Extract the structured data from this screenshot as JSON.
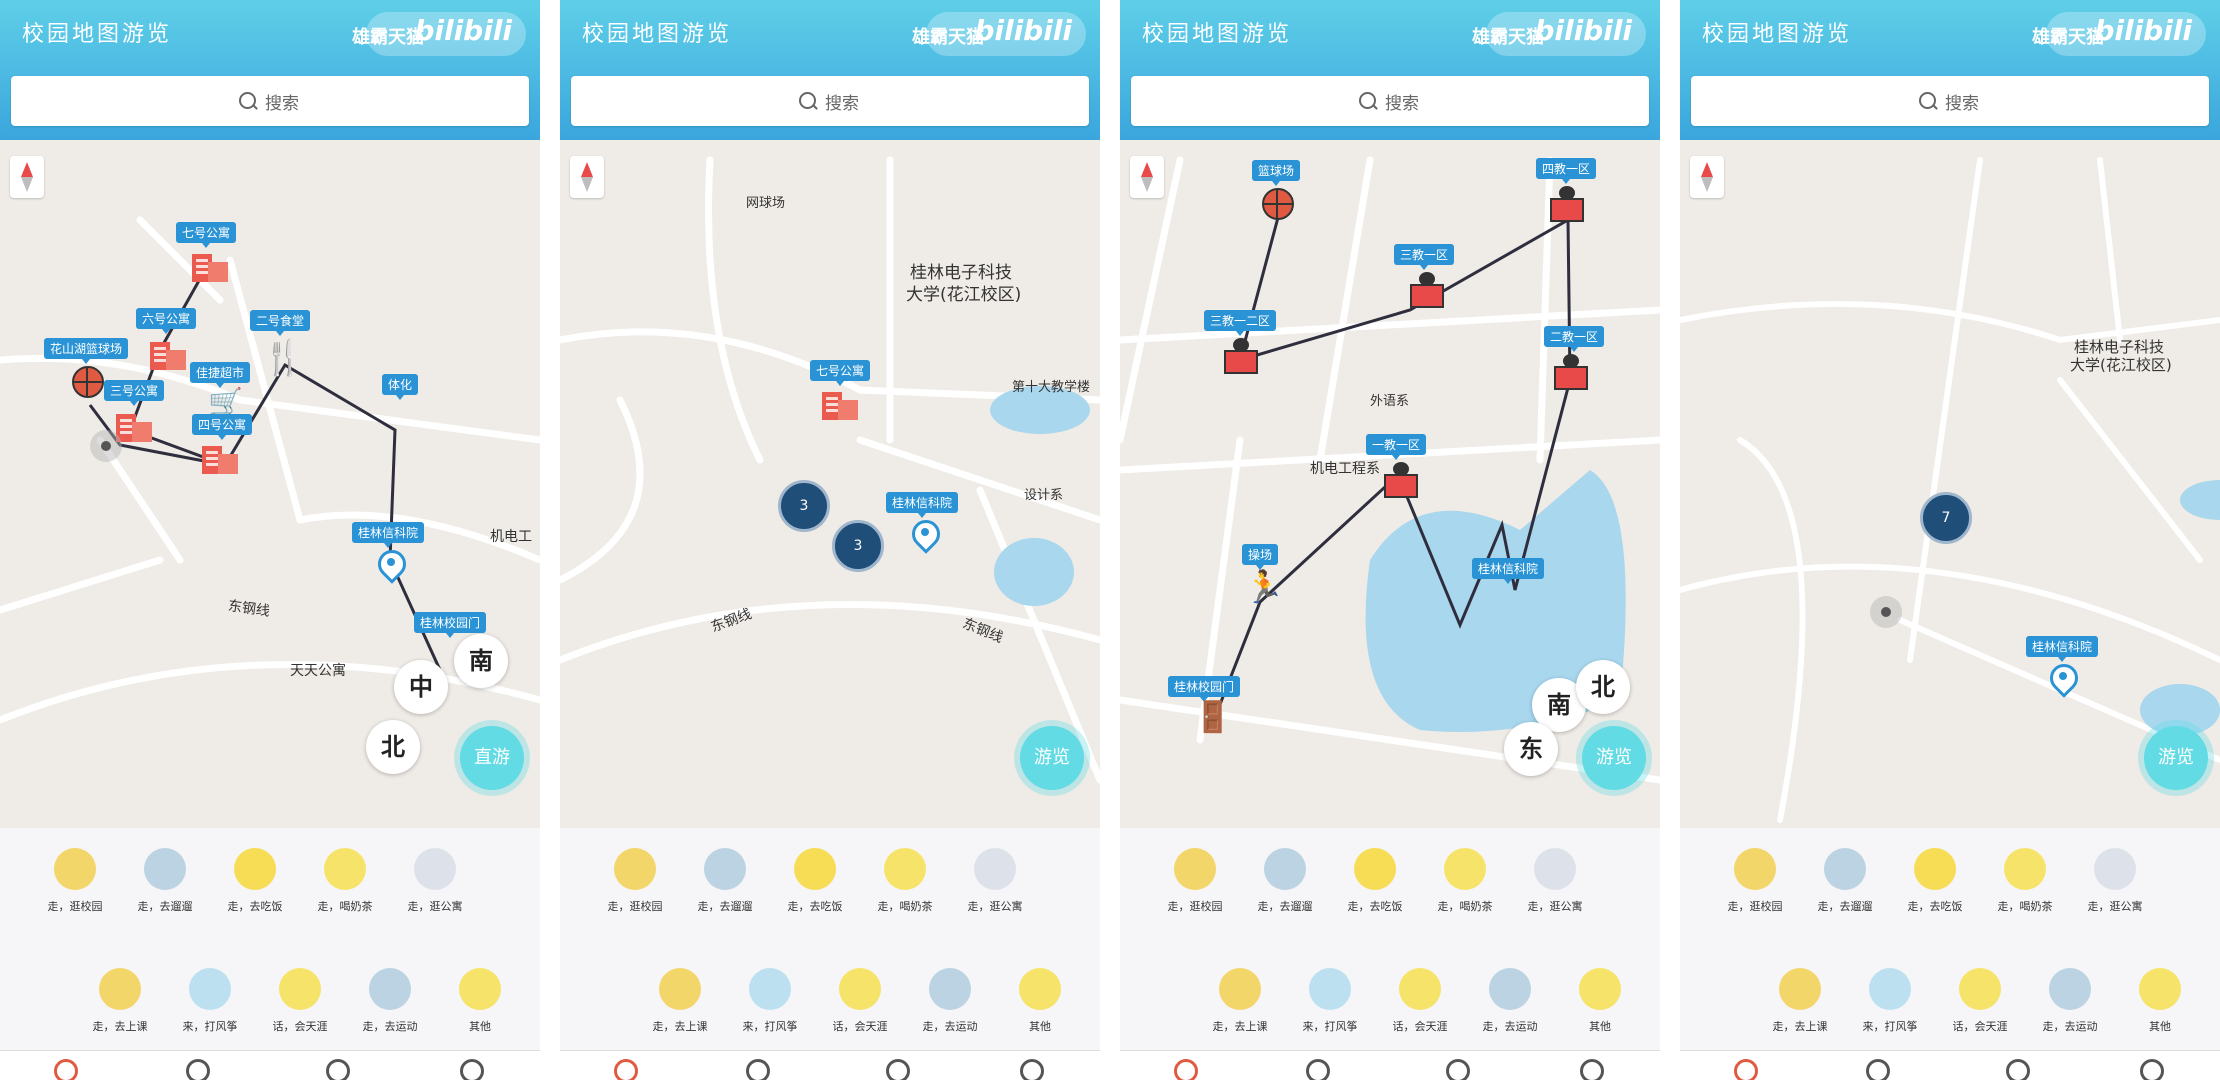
{
  "panels": [
    {
      "title": "校园地图游览",
      "brand_left": "雄霸天猫",
      "brand_right": "bilibili",
      "search": "搜索",
      "fab_label": "直游"
    },
    {
      "title": "校园地图游览",
      "brand_left": "雄霸天猫",
      "brand_right": "bilibili",
      "search": "搜索",
      "fab_label": "游览"
    },
    {
      "title": "校园地图游览",
      "brand_left": "雄霸天猫",
      "brand_right": "bilibili",
      "search": "搜索",
      "fab_label": "游览"
    },
    {
      "title": "校园地图游览",
      "brand_left": "雄霸天猫",
      "brand_right": "bilibili",
      "search": "搜索",
      "fab_label": "游览"
    }
  ],
  "menu_items": [
    {
      "label": "走，逛校园",
      "icon": "thumbs-up-icon",
      "color": "#f3d66a"
    },
    {
      "label": "走，去遛遛",
      "icon": "ball-icon",
      "color": "#bcd3e3"
    },
    {
      "label": "走，去吃饭",
      "icon": "egg-icon",
      "color": "#f7dd55"
    },
    {
      "label": "走，喝奶茶",
      "icon": "drink-icon",
      "color": "#f6e36a"
    },
    {
      "label": "走，逛公寓",
      "icon": "bear-icon",
      "color": "#dde2ea"
    },
    {
      "label": "走，去上课",
      "icon": "pencil-icon",
      "color": "#f3d66a"
    },
    {
      "label": "来，打风筝",
      "icon": "kite-icon",
      "color": "#bde0f0"
    },
    {
      "label": "话，会天涯",
      "icon": "paper-plane-icon",
      "color": "#f6e36a"
    },
    {
      "label": "走，去运动",
      "icon": "flower-icon",
      "color": "#bcd3e3"
    },
    {
      "label": "其他",
      "icon": "face-icon",
      "color": "#f6e36a"
    }
  ],
  "panel1": {
    "labels": [
      "七号公寓",
      "六号公寓",
      "二号食堂",
      "花山湖篮球场",
      "佳捷超市",
      "三号公寓",
      "四号公寓",
      "体化",
      "桂林信科院",
      "桂林校园门"
    ],
    "road": "东钢线",
    "place": "天天公寓",
    "edge": "机电工",
    "dir_buttons": [
      "中",
      "南",
      "北"
    ]
  },
  "panel2": {
    "labels": [
      "七号公寓",
      "桂林信科院"
    ],
    "places": [
      "网球场",
      "桂林电子科技",
      "大学(花江校区)",
      "第十大教学楼",
      "设计系"
    ],
    "clusters": [
      "3",
      "3"
    ],
    "road1": "东钢线",
    "road2": "东钢线"
  },
  "panel3": {
    "labels": [
      "篮球场",
      "四教一区",
      "三教一区",
      "三教一二区",
      "二教一区",
      "一教一区",
      "操场",
      "桂林校园门",
      "桂林信科院"
    ],
    "places": [
      "外语系",
      "机电工程系"
    ],
    "dir_buttons": [
      "南",
      "北",
      "东"
    ]
  },
  "panel4": {
    "labels": [
      "桂林信科院"
    ],
    "places": [
      "桂林电子科技",
      "大学(花江校区)"
    ],
    "clusters": [
      "7"
    ]
  }
}
